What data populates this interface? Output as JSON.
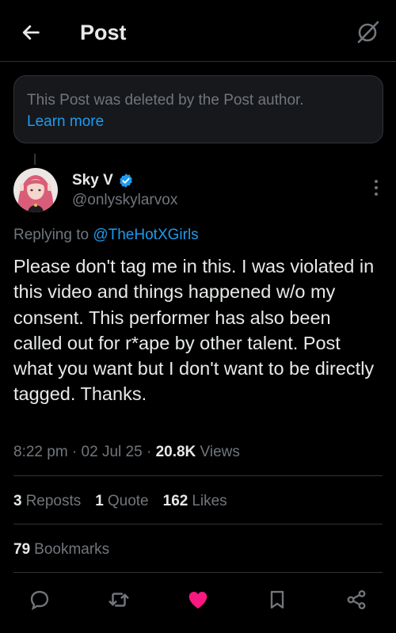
{
  "header": {
    "title": "Post",
    "back_icon": "arrow-left-icon",
    "grok_icon": "grok-icon"
  },
  "deleted_notice": {
    "text": "This Post was deleted by the Post author.",
    "link": "Learn more"
  },
  "author": {
    "display_name": "Sky V",
    "handle": "@onlyskylarvox",
    "verified": true
  },
  "reply_context": {
    "prefix": "Replying to",
    "mention": "@TheHotXGirls"
  },
  "post": {
    "text": "Please don't tag me in this. I was violated in this video and things happened w/o my consent. This performer has also been called out for r*ape by other talent. Post what you want but I don't want to be directly tagged. Thanks.",
    "time": "8:22 pm",
    "date": "02 Jul 25",
    "views_count": "20.8K",
    "views_label": "Views"
  },
  "stats": {
    "reposts_count": "3",
    "reposts_label": "Reposts",
    "quotes_count": "1",
    "quotes_label": "Quote",
    "likes_count": "162",
    "likes_label": "Likes",
    "bookmarks_count": "79",
    "bookmarks_label": "Bookmarks"
  },
  "actions": {
    "reply_icon": "reply-icon",
    "repost_icon": "repost-icon",
    "like_icon": "heart-icon",
    "bookmark_icon": "bookmark-icon",
    "share_icon": "share-icon"
  },
  "colors": {
    "background": "#000000",
    "text": "#e7e9ea",
    "secondary": "#71767b",
    "accent": "#1d9bf0",
    "like": "#f91880"
  }
}
